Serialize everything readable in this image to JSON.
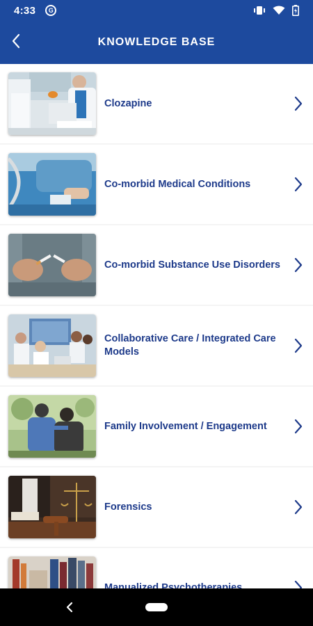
{
  "status_bar": {
    "time": "4:33",
    "app_icon_glyph": "G",
    "icons": [
      "vibrate-icon",
      "wifi-icon",
      "battery-icon"
    ]
  },
  "header": {
    "title": "KNOWLEDGE BASE",
    "back_icon": "chevron-left-icon",
    "background_color": "#1d4a9e"
  },
  "knowledge_base": {
    "items": [
      {
        "label": "Clozapine",
        "image": "clinic-consultation-photo"
      },
      {
        "label": "Co-morbid Medical Conditions",
        "image": "hospital-bed-patient-photo"
      },
      {
        "label": "Co-morbid Substance Use Disorders",
        "image": "breaking-cigarette-photo"
      },
      {
        "label": "Collaborative Care / Integrated Care Models",
        "image": "medical-team-meeting-photo"
      },
      {
        "label": "Family Involvement / Engagement",
        "image": "family-support-photo"
      },
      {
        "label": "Forensics",
        "image": "gavel-scales-photo"
      },
      {
        "label": "Manualized Psychotherapies",
        "image": "bookshelf-photo"
      }
    ],
    "label_color": "#1d3a8a"
  },
  "nav_bar": {
    "back_icon": "nav-back-icon",
    "home_icon": "home-pill-icon"
  }
}
